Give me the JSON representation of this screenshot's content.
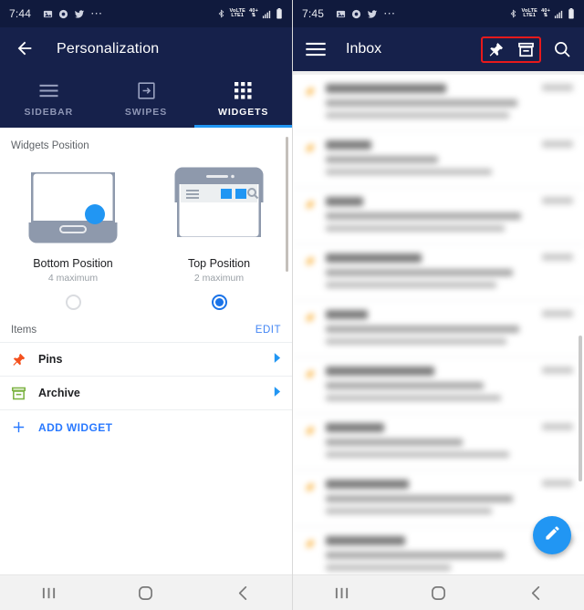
{
  "left": {
    "status_bar": {
      "time": "7:44",
      "left_icons": [
        "photos-icon",
        "record-icon",
        "twitter-icon",
        "more-dots-icon"
      ],
      "right_icons": [
        "bluetooth-icon",
        "volte-icon",
        "lte-icon",
        "signal-icon",
        "battery-icon"
      ],
      "volte_label": "VoLTE",
      "lte_label": "40+"
    },
    "appbar": {
      "back_icon": "back-arrow-icon",
      "title": "Personalization"
    },
    "tabs": [
      {
        "label": "SIDEBAR",
        "icon": "hamburger-icon",
        "active": false
      },
      {
        "label": "SWIPES",
        "icon": "swipe-arrow-icon",
        "active": false
      },
      {
        "label": "WIDGETS",
        "icon": "grid-dots-icon",
        "active": true
      }
    ],
    "accent_color": "#2196f3",
    "widgets_position": {
      "section_title": "Widgets Position",
      "options": [
        {
          "name": "Bottom Position",
          "max": "4 maximum",
          "selected": false,
          "art": "phone-bottom-fab"
        },
        {
          "name": "Top Position",
          "max": "2 maximum",
          "selected": true,
          "art": "phone-top-toolbar"
        }
      ]
    },
    "items": {
      "label": "Items",
      "edit_label": "EDIT",
      "rows": [
        {
          "label": "Pins",
          "icon": "pin-icon",
          "icon_color": "#f4511e",
          "chevron": "chevron-right-icon"
        },
        {
          "label": "Archive",
          "icon": "archive-icon",
          "icon_color": "#7cb342",
          "chevron": "chevron-right-icon"
        }
      ],
      "add_label": "ADD WIDGET",
      "add_icon": "plus-icon",
      "add_color": "#2979ff"
    },
    "navbar": [
      {
        "icon": "recents-icon"
      },
      {
        "icon": "home-icon"
      },
      {
        "icon": "back-icon"
      }
    ]
  },
  "right": {
    "status_bar": {
      "time": "7:45",
      "left_icons": [
        "photos-icon",
        "record-icon",
        "twitter-icon",
        "more-dots-icon"
      ],
      "right_icons": [
        "bluetooth-icon",
        "volte-icon",
        "lte-icon",
        "signal-icon",
        "battery-icon"
      ],
      "volte_label": "VoLTE",
      "lte_label": "40+"
    },
    "appbar": {
      "menu_icon": "hamburger-icon",
      "title": "Inbox",
      "highlight_color": "#e8191b",
      "highlighted_actions": [
        {
          "icon": "pin-icon"
        },
        {
          "icon": "archive-icon"
        }
      ],
      "search_icon": "search-icon"
    },
    "mail_list_rows": 9,
    "fab": {
      "icon": "compose-pencil-icon",
      "color": "#2196f3"
    },
    "navbar": [
      {
        "icon": "recents-icon"
      },
      {
        "icon": "home-icon"
      },
      {
        "icon": "back-icon"
      }
    ]
  }
}
